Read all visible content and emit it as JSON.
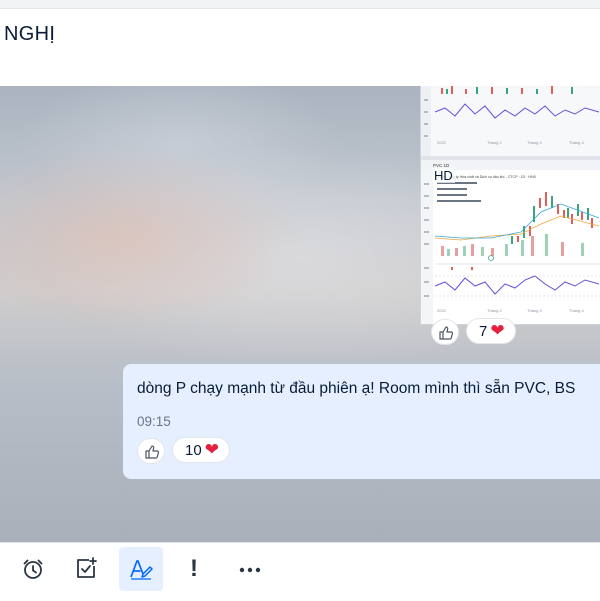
{
  "header": {
    "title": "NGHỊ"
  },
  "shared_image": {
    "badge": "HD",
    "chart_title_small": "PVC 1D",
    "company_line": "Tổng Công ty Hóa chất và Dịch vụ dầu khí - CTCP · 1D · HNX",
    "axis_months": [
      "2022",
      "Tháng 2",
      "Tháng 3",
      "Tháng 4"
    ],
    "reaction_count": "7"
  },
  "message": {
    "text": "dòng P chạy mạnh từ đầu phiên ạ! Room mình thì sẵn PVC, BS",
    "time": "09:15",
    "reaction_count": "10"
  },
  "colors": {
    "accent": "#0068ff",
    "bubble": "#e5efff",
    "heart": "#e5203f"
  },
  "toolbar": {
    "icons": [
      "alarm-clock-icon",
      "add-task-icon",
      "text-format-icon",
      "urgent-icon",
      "more-icon"
    ],
    "urgent_glyph": "!"
  }
}
